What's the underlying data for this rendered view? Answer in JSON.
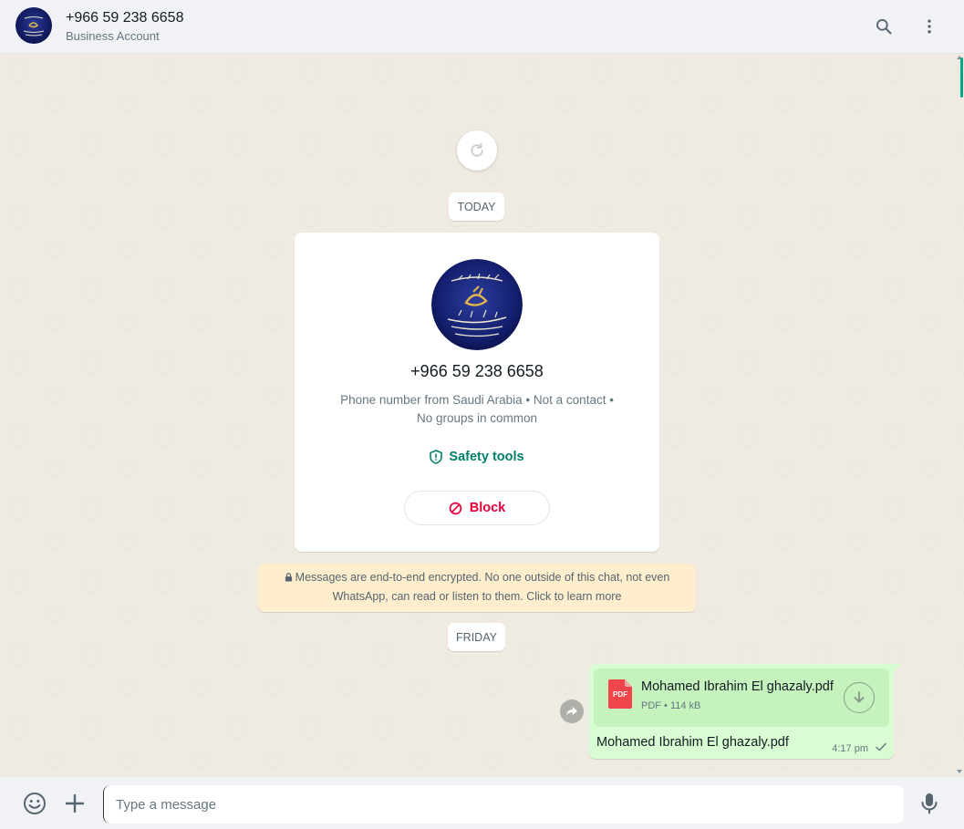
{
  "header": {
    "title": "+966 59 238 6658",
    "subtitle": "Business Account",
    "search_icon": "search-icon",
    "menu_icon": "kebab-menu-icon"
  },
  "chat": {
    "refresh_icon": "refresh-icon",
    "date_today": "TODAY",
    "date_friday": "FRIDAY",
    "contact_card": {
      "phone": "+966 59 238 6658",
      "description": "Phone number from Saudi Arabia • Not a contact • No groups in common",
      "safety_label": "Safety tools",
      "block_label": "Block"
    },
    "encryption_notice": "Messages are end-to-end encrypted. No one outside of this chat, not even WhatsApp, can read or listen to them. Click to learn more",
    "message": {
      "file_name": "Mohamed Ibrahim El ghazaly.pdf",
      "file_meta": "PDF • 114 kB",
      "file_badge": "PDF",
      "caption": "Mohamed Ibrahim El ghazaly.pdf",
      "time": "4:17 pm"
    }
  },
  "footer": {
    "placeholder": "Type a message"
  },
  "colors": {
    "accent": "#00a884",
    "link_green": "#008069",
    "danger": "#ea0038",
    "outgoing_bubble": "#d9fdd3",
    "notice_bg": "#ffeecd"
  }
}
